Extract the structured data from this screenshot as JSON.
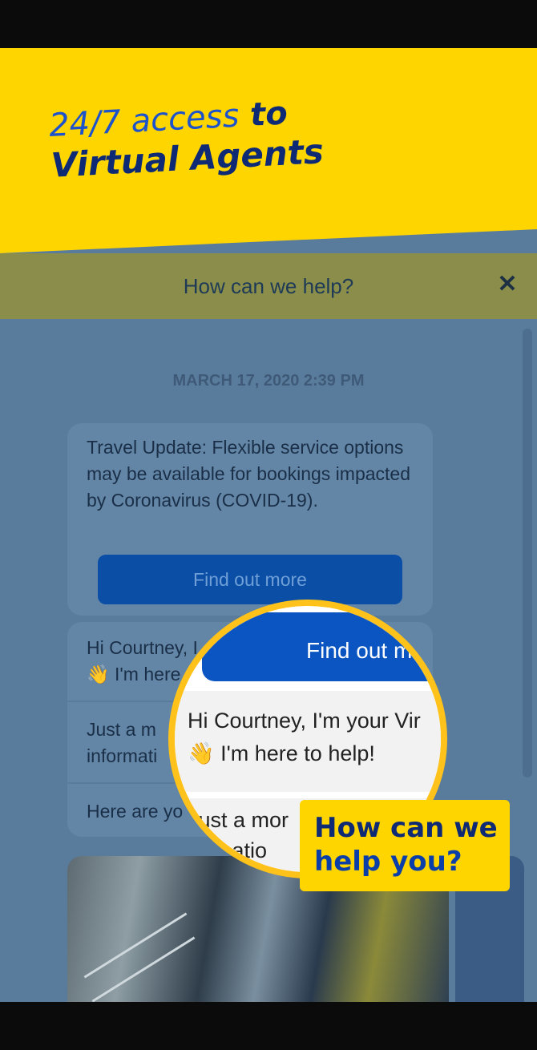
{
  "banner": {
    "headline_part1": "24/7 access",
    "headline_part2": " to",
    "headline_line2": "Virtual Agents"
  },
  "chat": {
    "header_title": "How can we help?",
    "timestamp": "MARCH 17, 2020 2:39 PM",
    "travel_update": "Travel Update: Flexible service options may be available for bookings impacted by Coronavirus (COVID-19).",
    "find_out_more": "Find out more",
    "greeting_line1": "Hi Courtney, I",
    "greeting_line2": "👋 I'm here",
    "moment_line1": "Just a m",
    "moment_line2": "informati",
    "here_are": "Here are yo"
  },
  "magnifier": {
    "button_label": "Find out m",
    "greeting_line1": "Hi Courtney, I'm your Vir",
    "greeting_line2": "👋 I'm here to help!",
    "moment_line1": "Just a mor",
    "moment_line2": "rmatio"
  },
  "callout": {
    "line1": "How can we",
    "line2": "help you?"
  },
  "colors": {
    "banner_yellow": "#ffd500",
    "accent_blue": "#0a55c2",
    "headline_navy": "#0f2a74"
  }
}
